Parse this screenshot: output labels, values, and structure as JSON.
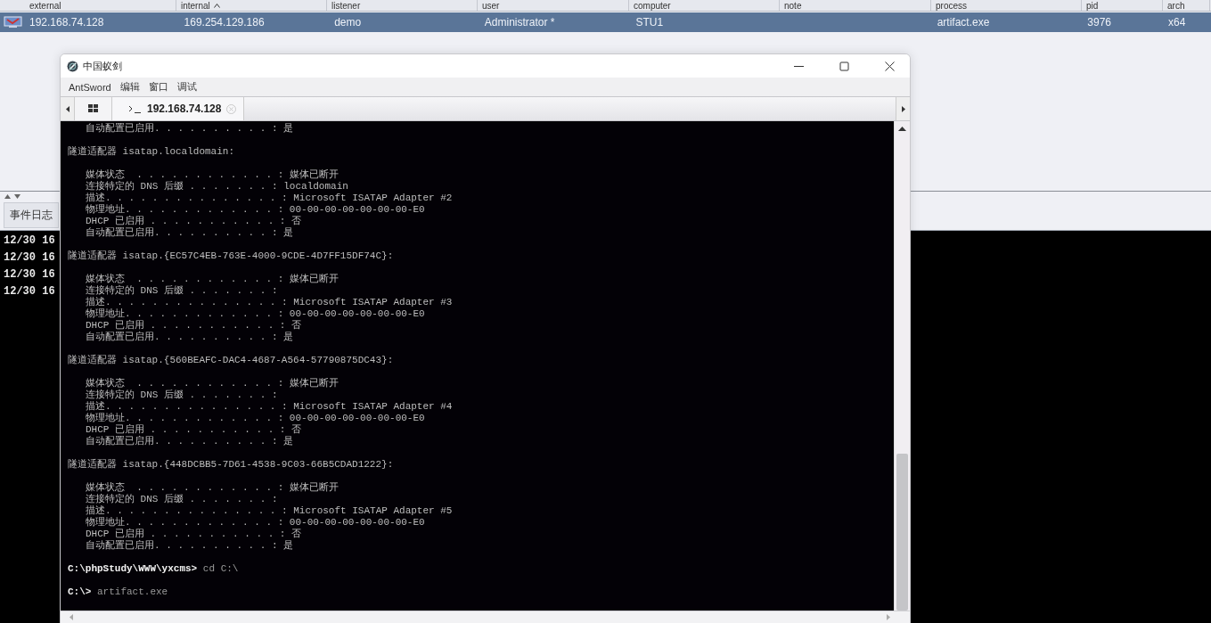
{
  "table": {
    "columns": [
      {
        "label": "external",
        "sorted": false
      },
      {
        "label": "internal",
        "sorted": true
      },
      {
        "label": "listener",
        "sorted": false
      },
      {
        "label": "user",
        "sorted": false
      },
      {
        "label": "computer",
        "sorted": false
      },
      {
        "label": "note",
        "sorted": false
      },
      {
        "label": "process",
        "sorted": false
      },
      {
        "label": "pid",
        "sorted": false
      },
      {
        "label": "arch",
        "sorted": false
      }
    ],
    "rows": [
      {
        "selected": true,
        "external": "192.168.74.128",
        "internal": "169.254.129.186",
        "listener": "demo",
        "user": "Administrator *",
        "computer": "STU1",
        "process": "artifact.exe",
        "pid": "3976",
        "arch": "x64"
      }
    ]
  },
  "event_log": {
    "tabs": [
      {
        "label": "事件日志",
        "selected": true
      }
    ],
    "lines": [
      "12/30 16",
      "12/30 16",
      "12/30 16",
      "12/30 16"
    ]
  },
  "window": {
    "title": "中国蚁剑",
    "menu": [
      "AntSword",
      "编辑",
      "窗口",
      "调试"
    ],
    "tabs": [
      {
        "label": "192.168.74.128",
        "selected": true
      }
    ],
    "terminal": [
      {
        "kind": "field",
        "text": "自动配置已启用. . . . . . . . . . : 是"
      },
      {
        "kind": "blank"
      },
      {
        "kind": "output",
        "text": "隧道适配器 isatap.localdomain:"
      },
      {
        "kind": "blank"
      },
      {
        "kind": "field",
        "text": "媒体状态  . . . . . . . . . . . . : 媒体已断开"
      },
      {
        "kind": "field",
        "text": "连接特定的 DNS 后缀 . . . . . . . : localdomain"
      },
      {
        "kind": "field",
        "text": "描述. . . . . . . . . . . . . . . : Microsoft ISATAP Adapter #2"
      },
      {
        "kind": "field",
        "text": "物理地址. . . . . . . . . . . . . : 00-00-00-00-00-00-00-E0"
      },
      {
        "kind": "field",
        "text": "DHCP 已启用 . . . . . . . . . . . : 否"
      },
      {
        "kind": "field",
        "text": "自动配置已启用. . . . . . . . . . : 是"
      },
      {
        "kind": "blank"
      },
      {
        "kind": "output",
        "text": "隧道适配器 isatap.{EC57C4EB-763E-4000-9CDE-4D7FF15DF74C}:"
      },
      {
        "kind": "blank"
      },
      {
        "kind": "field",
        "text": "媒体状态  . . . . . . . . . . . . : 媒体已断开"
      },
      {
        "kind": "field",
        "text": "连接特定的 DNS 后缀 . . . . . . . :"
      },
      {
        "kind": "field",
        "text": "描述. . . . . . . . . . . . . . . : Microsoft ISATAP Adapter #3"
      },
      {
        "kind": "field",
        "text": "物理地址. . . . . . . . . . . . . : 00-00-00-00-00-00-00-E0"
      },
      {
        "kind": "field",
        "text": "DHCP 已启用 . . . . . . . . . . . : 否"
      },
      {
        "kind": "field",
        "text": "自动配置已启用. . . . . . . . . . : 是"
      },
      {
        "kind": "blank"
      },
      {
        "kind": "output",
        "text": "隧道适配器 isatap.{560BEAFC-DAC4-4687-A564-57790875DC43}:"
      },
      {
        "kind": "blank"
      },
      {
        "kind": "field",
        "text": "媒体状态  . . . . . . . . . . . . : 媒体已断开"
      },
      {
        "kind": "field",
        "text": "连接特定的 DNS 后缀 . . . . . . . :"
      },
      {
        "kind": "field",
        "text": "描述. . . . . . . . . . . . . . . : Microsoft ISATAP Adapter #4"
      },
      {
        "kind": "field",
        "text": "物理地址. . . . . . . . . . . . . : 00-00-00-00-00-00-00-E0"
      },
      {
        "kind": "field",
        "text": "DHCP 已启用 . . . . . . . . . . . : 否"
      },
      {
        "kind": "field",
        "text": "自动配置已启用. . . . . . . . . . : 是"
      },
      {
        "kind": "blank"
      },
      {
        "kind": "output",
        "text": "隧道适配器 isatap.{448DCBB5-7D61-4538-9C03-66B5CDAD1222}:"
      },
      {
        "kind": "blank"
      },
      {
        "kind": "field",
        "text": "媒体状态  . . . . . . . . . . . . : 媒体已断开"
      },
      {
        "kind": "field",
        "text": "连接特定的 DNS 后缀 . . . . . . . :"
      },
      {
        "kind": "field",
        "text": "描述. . . . . . . . . . . . . . . : Microsoft ISATAP Adapter #5"
      },
      {
        "kind": "field",
        "text": "物理地址. . . . . . . . . . . . . : 00-00-00-00-00-00-00-E0"
      },
      {
        "kind": "field",
        "text": "DHCP 已启用 . . . . . . . . . . . : 否"
      },
      {
        "kind": "field",
        "text": "自动配置已启用. . . . . . . . . . : 是"
      },
      {
        "kind": "blank"
      },
      {
        "kind": "prompt",
        "text": "**C:\\phpStudy\\WWW\\yxcms>** cd C:\\"
      },
      {
        "kind": "blank"
      },
      {
        "kind": "prompt",
        "text": "**C:\\>** artifact.exe"
      }
    ]
  }
}
